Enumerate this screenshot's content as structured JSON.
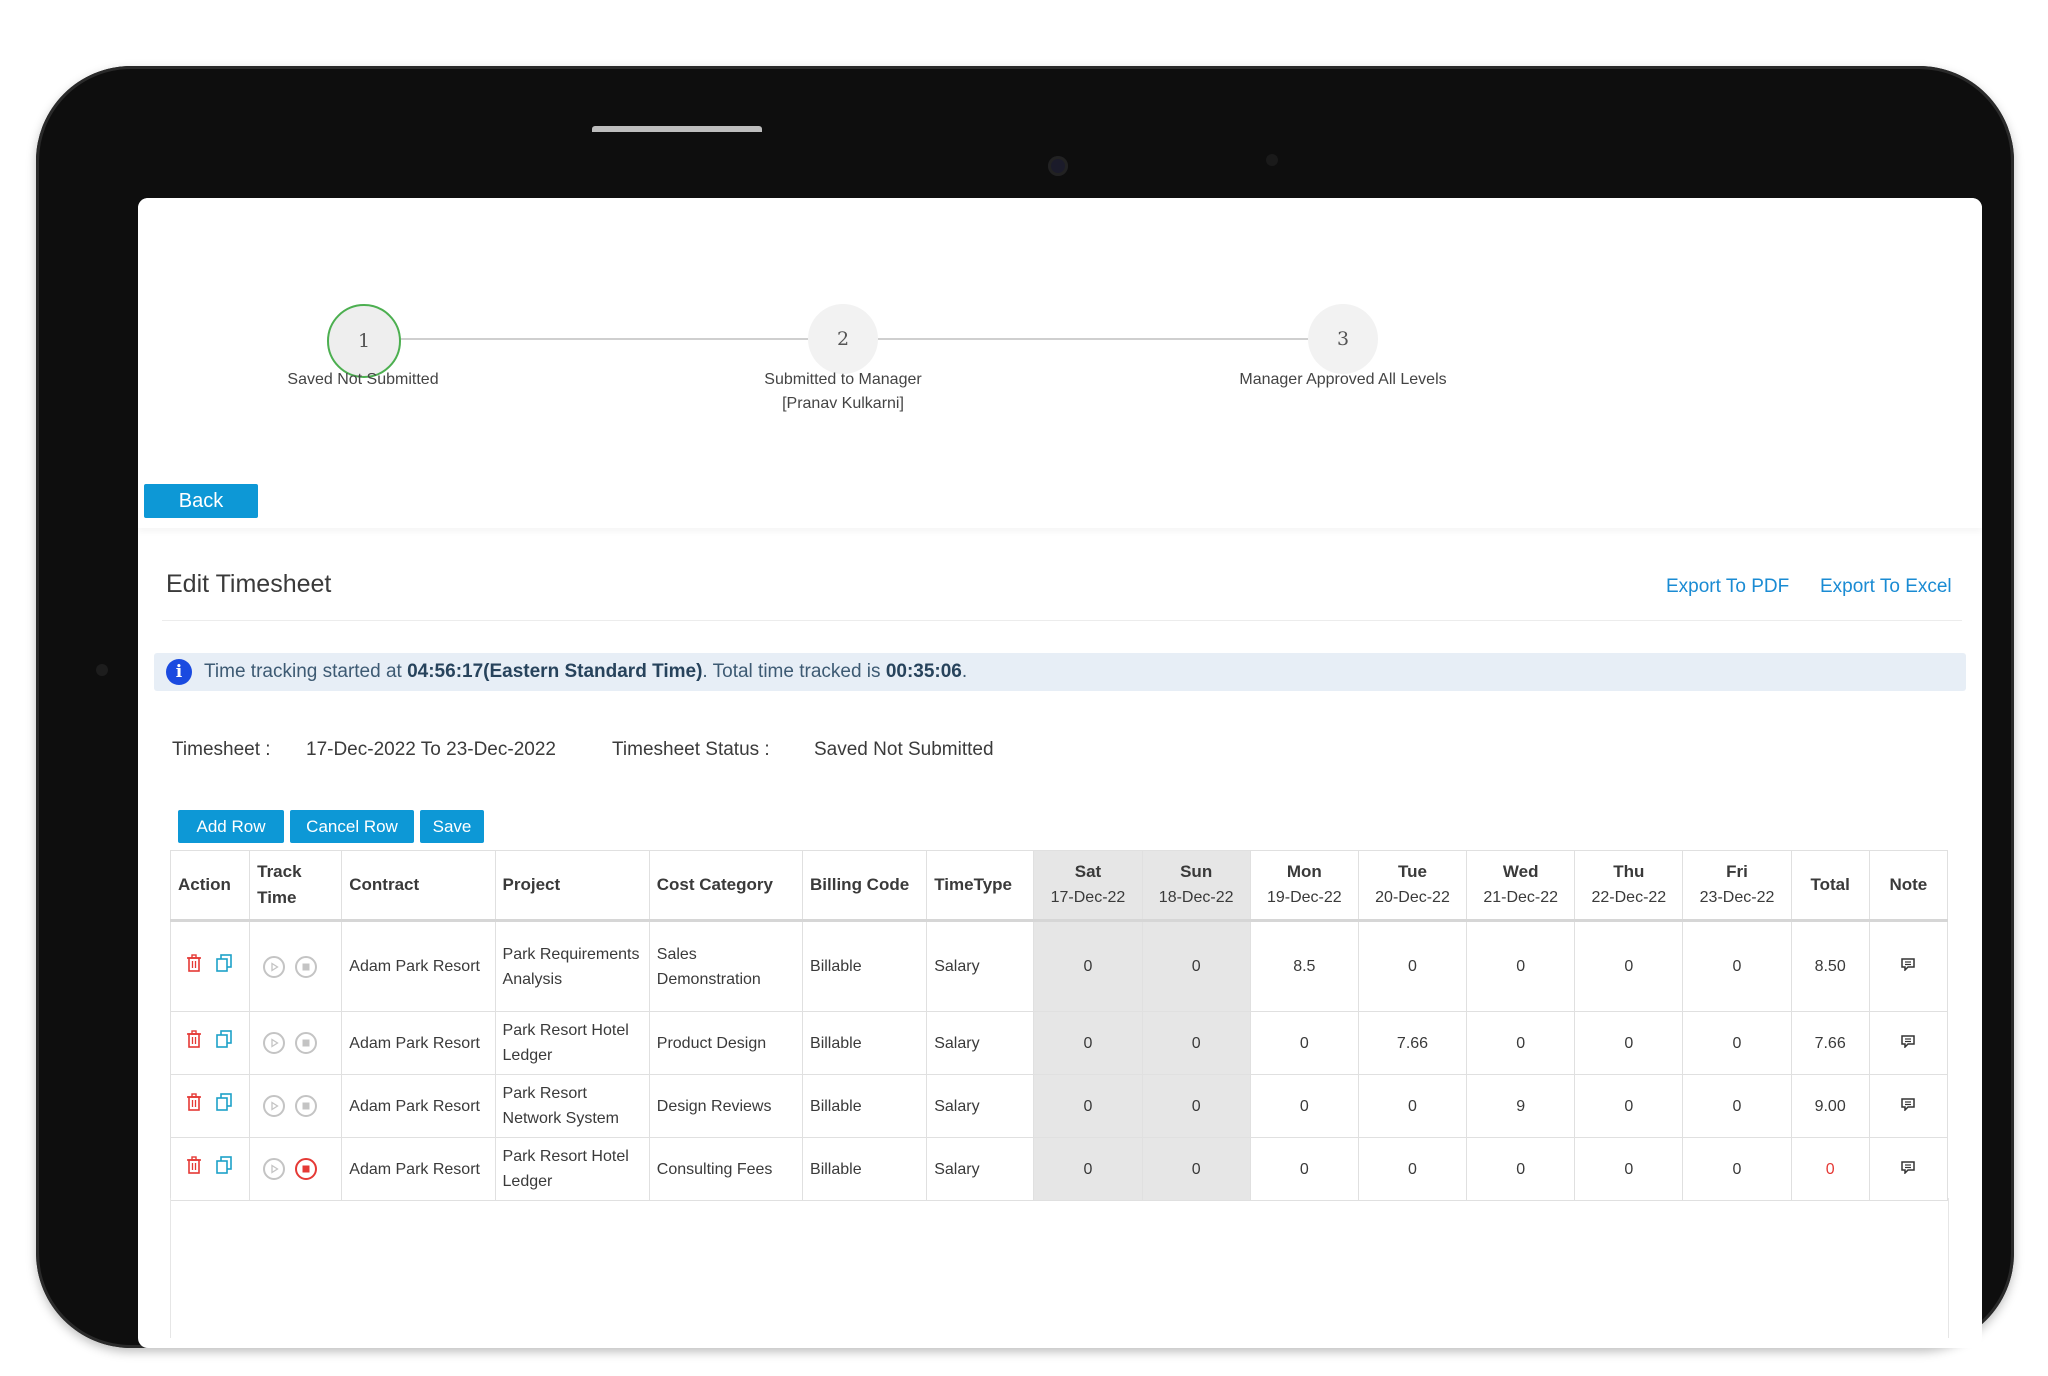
{
  "steps": [
    {
      "number": "1",
      "label": "Saved Not Submitted",
      "sublabel": ""
    },
    {
      "number": "2",
      "label": "Submitted to Manager",
      "sublabel": "[Pranav Kulkarni]"
    },
    {
      "number": "3",
      "label": "Manager Approved All Levels",
      "sublabel": ""
    }
  ],
  "back_label": "Back",
  "page_title": "Edit Timesheet",
  "export": {
    "pdf": "Export To PDF",
    "excel": "Export To Excel"
  },
  "info": {
    "prefix": "Time tracking started at ",
    "start_time": "04:56:17(Eastern Standard Time)",
    "middle": ". Total time tracked is ",
    "total": "00:35:06",
    "suffix": "."
  },
  "meta": {
    "timesheet_label": "Timesheet :",
    "timesheet_value": "17-Dec-2022 To 23-Dec-2022",
    "status_label": "Timesheet Status :",
    "status_value": "Saved Not Submitted"
  },
  "toolbar": {
    "add_row": "Add Row",
    "cancel_row": "Cancel Row",
    "save": "Save"
  },
  "columns": {
    "action": "Action",
    "track": "Track Time",
    "contract": "Contract",
    "project": "Project",
    "cost": "Cost Category",
    "billing": "Billing Code",
    "timetype": "TimeType",
    "total": "Total",
    "note": "Note"
  },
  "days": [
    {
      "name": "Sat",
      "date": "17-Dec-22"
    },
    {
      "name": "Sun",
      "date": "18-Dec-22"
    },
    {
      "name": "Mon",
      "date": "19-Dec-22"
    },
    {
      "name": "Tue",
      "date": "20-Dec-22"
    },
    {
      "name": "Wed",
      "date": "21-Dec-22"
    },
    {
      "name": "Thu",
      "date": "22-Dec-22"
    },
    {
      "name": "Fri",
      "date": "23-Dec-22"
    }
  ],
  "rows": [
    {
      "contract": "Adam Park Resort",
      "project": "Park Requirements Analysis",
      "cost": "Sales Demonstration",
      "billing": "Billable",
      "timetype": "Salary",
      "hours": [
        "0",
        "0",
        "8.5",
        "0",
        "0",
        "0",
        "0"
      ],
      "total": "8.50"
    },
    {
      "contract": "Adam Park Resort",
      "project": "Park Resort Hotel Ledger",
      "cost": "Product Design",
      "billing": "Billable",
      "timetype": "Salary",
      "hours": [
        "0",
        "0",
        "0",
        "7.66",
        "0",
        "0",
        "0"
      ],
      "total": "7.66"
    },
    {
      "contract": "Adam Park Resort",
      "project": "Park Resort Network System",
      "cost": "Design Reviews",
      "billing": "Billable",
      "timetype": "Salary",
      "hours": [
        "0",
        "0",
        "0",
        "0",
        "9",
        "0",
        "0"
      ],
      "total": "9.00"
    },
    {
      "contract": "Adam Park Resort",
      "project": "Park Resort Hotel Ledger",
      "cost": "Consulting Fees",
      "billing": "Billable",
      "timetype": "Salary",
      "hours": [
        "0",
        "0",
        "0",
        "0",
        "0",
        "0",
        "0"
      ],
      "total": "0"
    }
  ],
  "colors": {
    "accent": "#0d98d6",
    "link": "#1a8bd3",
    "danger": "#e53935",
    "step_active": "#4caf50"
  }
}
